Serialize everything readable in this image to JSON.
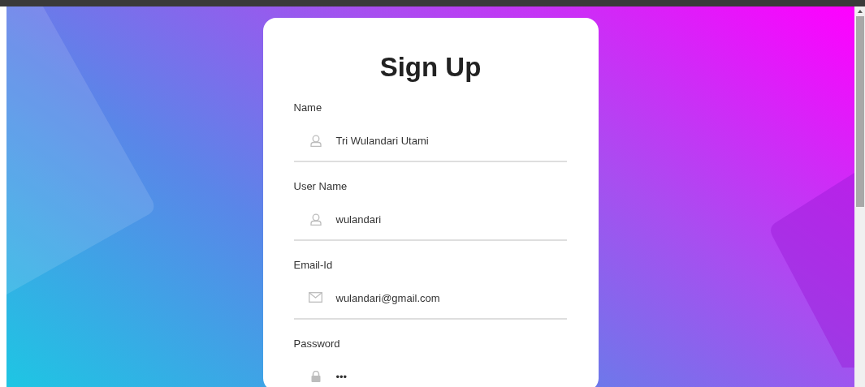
{
  "title": "Sign Up",
  "fields": [
    {
      "label": "Name",
      "value": "Tri Wulandari Utami",
      "kind": "person"
    },
    {
      "label": "User Name",
      "value": "wulandari",
      "kind": "person"
    },
    {
      "label": "Email-Id",
      "value": "wulandari@gmail.com",
      "kind": "mail"
    },
    {
      "label": "Password",
      "value": "•••",
      "kind": "lock"
    }
  ]
}
